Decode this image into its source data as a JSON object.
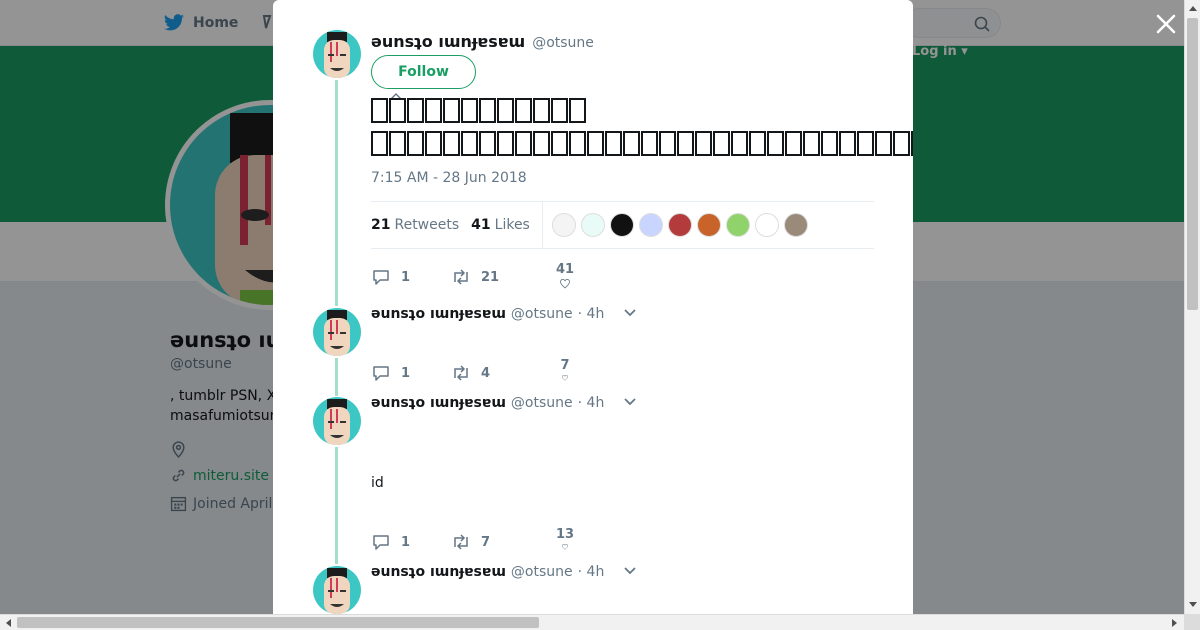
{
  "background": {
    "nav_home_label": "Home",
    "login_label": "Log in",
    "profile_name": "ǝunsʇo ıɯnɟɐsɐɯ",
    "profile_name_visible": "ǝunsʇo ıu",
    "profile_handle": "@otsune",
    "bio_line1": ", tumblr PSN, X",
    "bio_line2": "masafumiotsun",
    "website": "miteru.site",
    "joined": "Joined April"
  },
  "tweet": {
    "author_name": "ǝunsʇo ıɯnɟɐsɐɯ",
    "author_handle": "@otsune",
    "follow_label": "Follow",
    "timestamp": "7:15 AM - 28 Jun 2018",
    "retweets_count": "21",
    "retweets_label": "Retweets",
    "likes_count": "41",
    "likes_label": "Likes",
    "actions": {
      "replies": "1",
      "retweets": "21",
      "likes": "41"
    }
  },
  "replies": [
    {
      "name": "ǝunsʇo ıɯnɟɐsɐɯ",
      "handle": "@otsune",
      "time": "· 4h",
      "text": "",
      "replies": "1",
      "retweets": "4",
      "likes": "7"
    },
    {
      "name": "ǝunsʇo ıɯnɟɐsɐɯ",
      "handle": "@otsune",
      "time": "· 4h",
      "text": "id",
      "replies": "1",
      "retweets": "7",
      "likes": "13"
    },
    {
      "name": "ǝunsʇo ıɯnɟɐsɐɯ",
      "handle": "@otsune",
      "time": "· 4h",
      "text": "",
      "replies": "",
      "retweets": "",
      "likes": ""
    }
  ],
  "liker_colors": [
    "#f4f4f4",
    "#e9fbf7",
    "#111111",
    "#c9d5ff",
    "#b33b3b",
    "#c8632a",
    "#8fd36a",
    "#ffffff",
    "#9a8a7a"
  ],
  "colors": {
    "accent": "#1b9e63",
    "thread": "#a3e0cb",
    "avatar_bg": "#3cc7c4"
  }
}
